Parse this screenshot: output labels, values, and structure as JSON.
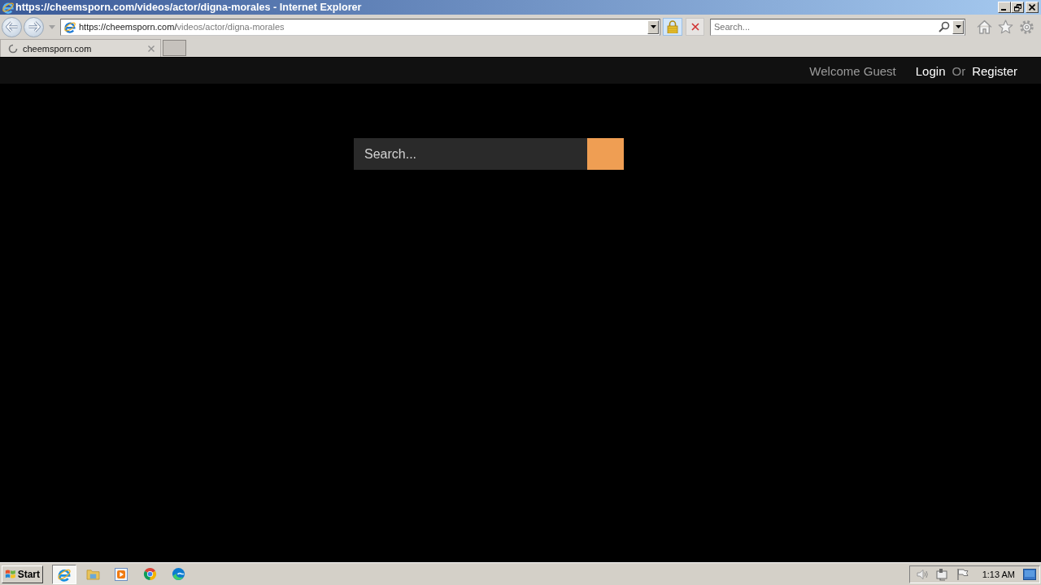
{
  "browser": {
    "title": "https://cheemsporn.com/videos/actor/digna-morales - Internet Explorer",
    "address": {
      "host": "https://cheemsporn.com/",
      "path": "videos/actor/digna-morales"
    },
    "search": {
      "placeholder": "Search..."
    },
    "tabs": [
      {
        "label": "cheemsporn.com",
        "selected": true,
        "loading": true
      }
    ]
  },
  "page": {
    "header": {
      "welcome": "Welcome Guest",
      "login": "Login",
      "separator": "Or",
      "register": "Register"
    },
    "search": {
      "placeholder": "Search..."
    }
  },
  "taskbar": {
    "start": "Start",
    "apps": [
      {
        "kind": "ie",
        "selected": true
      },
      {
        "kind": "folder",
        "selected": false
      },
      {
        "kind": "player",
        "selected": false
      },
      {
        "kind": "chrome",
        "selected": false
      },
      {
        "kind": "edge",
        "selected": false
      }
    ],
    "clock": "1:13 AM"
  }
}
